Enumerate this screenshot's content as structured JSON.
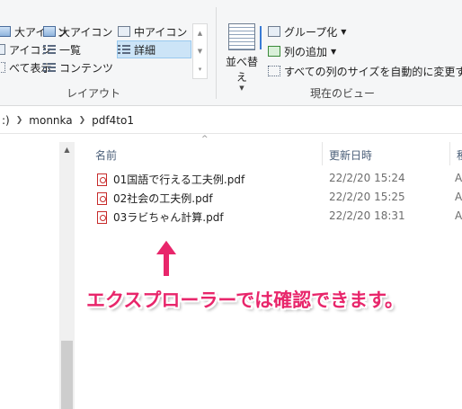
{
  "ribbon": {
    "layout_items": [
      {
        "label": "大アイコン",
        "icon": "extra-large-icons-icon"
      },
      {
        "label": "大アイコン",
        "icon": "large-icons-icon"
      },
      {
        "label": "中アイコン",
        "icon": "medium-icons-icon"
      },
      {
        "label": "アイコン",
        "icon": "small-icons-icon"
      },
      {
        "label": "一覧",
        "icon": "list-view-icon"
      },
      {
        "label": "詳細",
        "icon": "details-view-icon",
        "selected": true
      },
      {
        "label": "べて表示",
        "icon": "tiles-view-icon"
      },
      {
        "label": "コンテンツ",
        "icon": "content-view-icon"
      }
    ],
    "layout_group_label": "レイアウト",
    "sort_by_label": "並べ替え",
    "group_by_label": "グループ化",
    "add_columns_label": "列の追加",
    "size_all_columns_label": "すべての列のサイズを自動的に変更する",
    "current_view_group_label": "現在のビュー"
  },
  "address": {
    "parts": [
      ":)",
      "monnka",
      "pdf4to1"
    ]
  },
  "columns": {
    "name": "名前",
    "date_modified": "更新日時",
    "next_partial": "種"
  },
  "files": [
    {
      "name": "01国語で行える工夫例.pdf",
      "date": "22/2/20 15:24",
      "extra": "A"
    },
    {
      "name": "02社会の工夫例.pdf",
      "date": "22/2/20 15:25",
      "extra": "A"
    },
    {
      "name": "03ラビちゃん計算.pdf",
      "date": "22/2/20 18:31",
      "extra": "A"
    }
  ],
  "annotation": {
    "text": "エクスプローラーでは確認できます。",
    "color": "#e8266b"
  },
  "colors": {
    "ribbon_bg": "#f5f6f7",
    "selected_bg": "#cce4f7",
    "header_text": "#4c607a",
    "pdf_red": "#c72b2b"
  }
}
